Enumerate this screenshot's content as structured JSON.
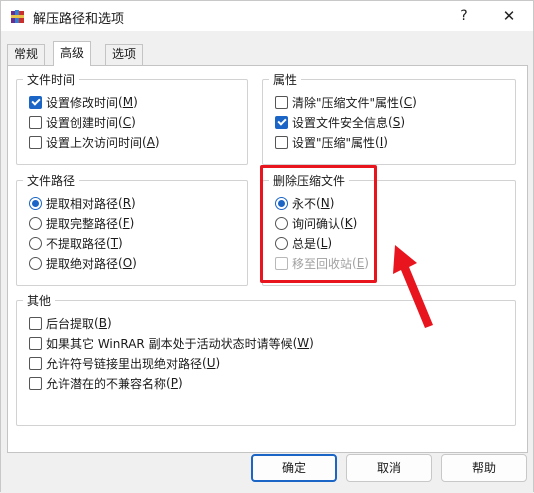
{
  "window": {
    "title": "解压路径和选项",
    "help_glyph": "?",
    "close_glyph": "✕",
    "app_icon": "winrar-books-icon"
  },
  "tabs": [
    {
      "label": "常规",
      "active": false
    },
    {
      "label": "高级",
      "active": true
    },
    {
      "label": "选项",
      "active": false
    }
  ],
  "file_time": {
    "title": "文件时间",
    "items": [
      {
        "label": "设置修改时间",
        "accel": "M",
        "checked": true
      },
      {
        "label": "设置创建时间",
        "accel": "C",
        "checked": false
      },
      {
        "label": "设置上次访问时间",
        "accel": "A",
        "checked": false
      }
    ]
  },
  "attributes": {
    "title": "属性",
    "items": [
      {
        "label": "清除\"压缩文件\"属性",
        "accel": "C",
        "checked": false
      },
      {
        "label": "设置文件安全信息",
        "accel": "S",
        "checked": true
      },
      {
        "label": "设置\"压缩\"属性",
        "accel": "I",
        "checked": false
      }
    ]
  },
  "file_path": {
    "title": "文件路径",
    "items": [
      {
        "label": "提取相对路径",
        "accel": "R",
        "checked": true
      },
      {
        "label": "提取完整路径",
        "accel": "F",
        "checked": false
      },
      {
        "label": "不提取路径",
        "accel": "T",
        "checked": false
      },
      {
        "label": "提取绝对路径",
        "accel": "O",
        "checked": false
      }
    ]
  },
  "delete_archive": {
    "title": "删除压缩文件",
    "items": [
      {
        "label": "永不",
        "accel": "N",
        "checked": true
      },
      {
        "label": "询问确认",
        "accel": "K",
        "checked": false
      },
      {
        "label": "总是",
        "accel": "L",
        "checked": false
      }
    ],
    "recycle": {
      "label": "移至回收站",
      "accel": "E",
      "checked": false,
      "disabled": true
    }
  },
  "misc": {
    "title": "其他",
    "items": [
      {
        "label": "后台提取",
        "accel": "B",
        "checked": false
      },
      {
        "label": "如果其它 WinRAR 副本处于活动状态时请等候",
        "accel": "W",
        "checked": false
      },
      {
        "label": "允许符号链接里出现绝对路径",
        "accel": "U",
        "checked": false
      },
      {
        "label": "允许潜在的不兼容名称",
        "accel": "P",
        "checked": false
      }
    ]
  },
  "buttons": {
    "ok": "确定",
    "cancel": "取消",
    "help": "帮助"
  },
  "colors": {
    "accent": "#1a65c5",
    "highlight": "#e8141e"
  }
}
